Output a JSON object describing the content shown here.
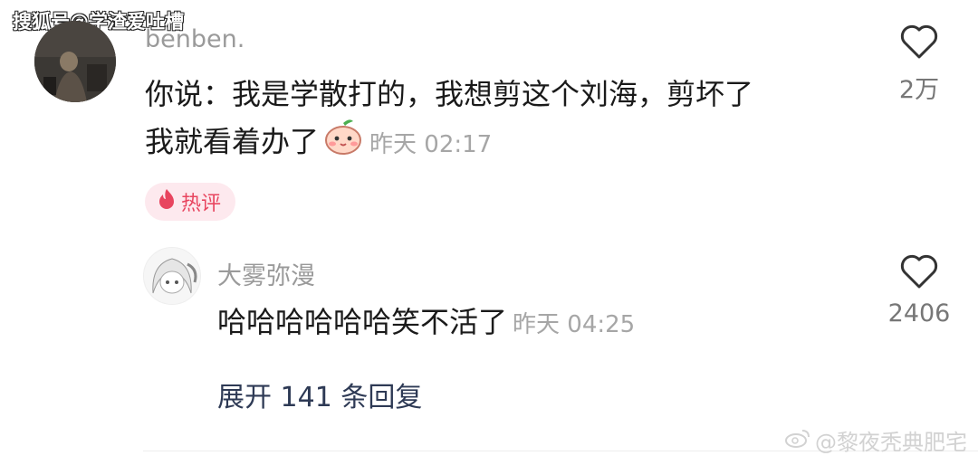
{
  "watermark_top": "搜狐号@学渣爱吐槽",
  "comment": {
    "username": "benben.",
    "text_line1": "你说：我是学散打的，我想剪这个刘海，剪坏了",
    "text_line2": "我就看着办了",
    "emoji": "peach-face-emoji",
    "time": "昨天 02:17",
    "hot_badge": "热评",
    "likes": "2万"
  },
  "reply": {
    "username": "大雾弥漫",
    "text": "哈哈哈哈哈哈笑不活了",
    "time": "昨天 04:25",
    "likes": "2406"
  },
  "expand_replies": "展开 141 条回复",
  "watermark_bottom": "@黎夜秃典肥宅",
  "colors": {
    "hot_badge_bg": "#fde9ee",
    "hot_badge_text": "#e8455f",
    "username": "#9a9a9a",
    "meta": "#a6a6a6",
    "expand": "#2e3a55"
  }
}
